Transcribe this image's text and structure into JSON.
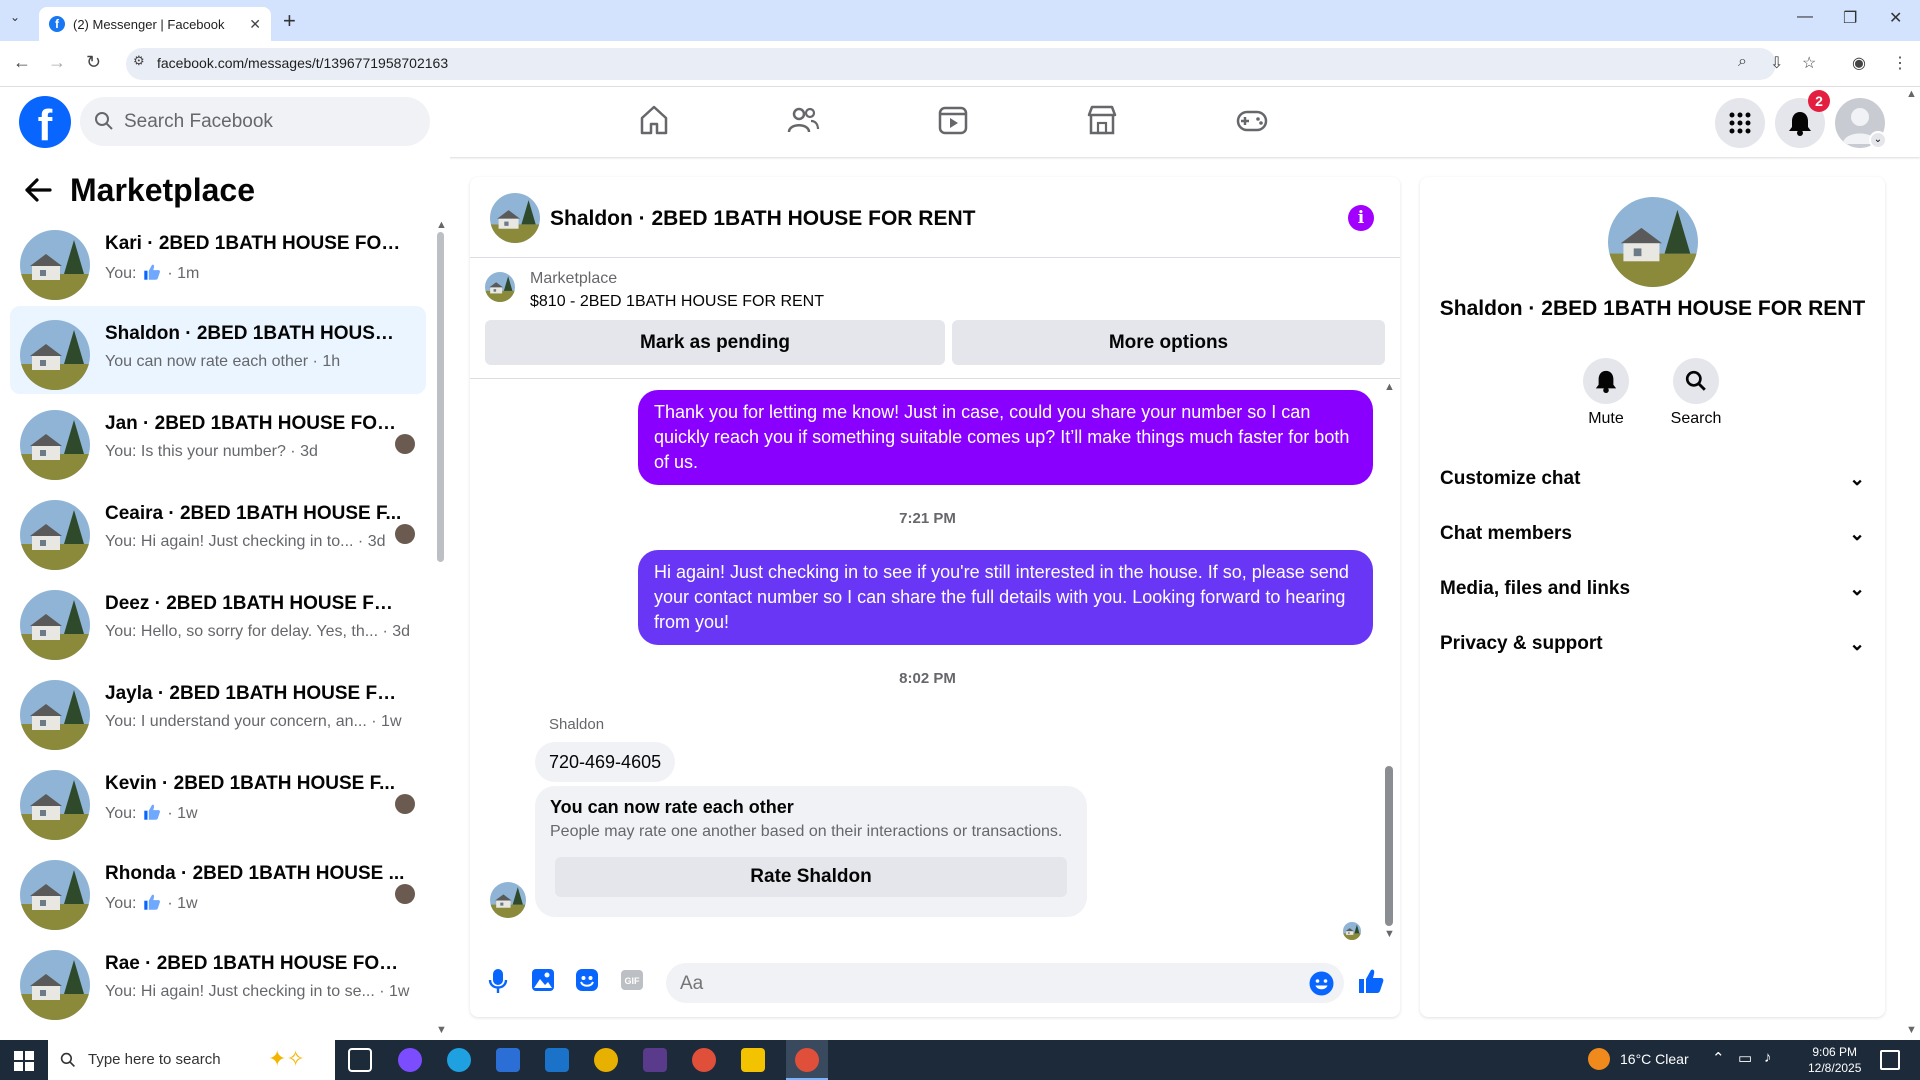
{
  "browser": {
    "tab_title": "(2) Messenger | Facebook",
    "url": "facebook.com/messages/t/1396771958702163"
  },
  "fb": {
    "search_placeholder": "Search Facebook",
    "notification_count": "2"
  },
  "left": {
    "title": "Marketplace",
    "conversations": [
      {
        "name": "Kari · 2BED 1BATH HOUSE FOR R...",
        "preview_prefix": "You:",
        "preview": "",
        "has_like": true,
        "time": "1m",
        "selected": false,
        "small_avatar": false
      },
      {
        "name": "Shaldon · 2BED 1BATH HOUSE F...",
        "preview_prefix": "",
        "preview": "You can now rate each other",
        "has_like": false,
        "time": "1h",
        "selected": true,
        "small_avatar": false
      },
      {
        "name": "Jan · 2BED 1BATH HOUSE FOR ...",
        "preview_prefix": "You:",
        "preview": "Is this your number?",
        "has_like": false,
        "time": "3d",
        "selected": false,
        "small_avatar": true
      },
      {
        "name": "Ceaira · 2BED 1BATH HOUSE F...",
        "preview_prefix": "You:",
        "preview": "Hi again! Just checking in to...",
        "has_like": false,
        "time": "3d",
        "selected": false,
        "small_avatar": true
      },
      {
        "name": "Deez · 2BED 1BATH HOUSE FOR ...",
        "preview_prefix": "You:",
        "preview": "Hello, so sorry for delay. Yes, th...",
        "has_like": false,
        "time": "3d",
        "selected": false,
        "small_avatar": false
      },
      {
        "name": "Jayla · 2BED 1BATH HOUSE FOR ...",
        "preview_prefix": "You:",
        "preview": "I understand your concern, an...",
        "has_like": false,
        "time": "1w",
        "selected": false,
        "small_avatar": false
      },
      {
        "name": "Kevin · 2BED 1BATH HOUSE F...",
        "preview_prefix": "You:",
        "preview": "",
        "has_like": true,
        "time": "1w",
        "selected": false,
        "small_avatar": true
      },
      {
        "name": "Rhonda · 2BED 1BATH HOUSE ...",
        "preview_prefix": "You:",
        "preview": "",
        "has_like": true,
        "time": "1w",
        "selected": false,
        "small_avatar": true
      },
      {
        "name": "Rae · 2BED 1BATH HOUSE FOR R...",
        "preview_prefix": "You:",
        "preview": "Hi again! Just checking in to se...",
        "has_like": false,
        "time": "1w",
        "selected": false,
        "small_avatar": false
      }
    ]
  },
  "chat": {
    "title": "Shaldon · 2BED 1BATH HOUSE FOR RENT",
    "marketplace_label": "Marketplace",
    "item": "$810 - 2BED 1BATH HOUSE FOR RENT",
    "btn_pending": "Mark as pending",
    "btn_more": "More options",
    "msg1": "Thank you for letting me know! Just in case, could you share your number so I can quickly reach you if something suitable comes up? It’ll make things much faster for both of us.",
    "time1": "7:21 PM",
    "msg2": "Hi again! Just checking in to see if you're still interested in the house. If so, please send your contact number so I can share the full details with you. Looking forward to hearing from you!",
    "time2": "8:02 PM",
    "sender": "Shaldon",
    "phone": "720-469-4605",
    "rate_title": "You can now rate each other",
    "rate_desc": "People may rate one another based on their interactions or transactions.",
    "rate_btn": "Rate Shaldon",
    "input_placeholder": "Aa",
    "colors": {
      "bubble1": "#8a00ff",
      "bubble2": "#6a36f5",
      "accent": "#0866ff",
      "info": "#a100ff"
    }
  },
  "right": {
    "name": "Shaldon · 2BED 1BATH HOUSE FOR RENT",
    "mute": "Mute",
    "search": "Search",
    "sections": [
      "Customize chat",
      "Chat members",
      "Media, files and links",
      "Privacy & support"
    ]
  },
  "taskbar": {
    "search": "Type here to search",
    "weather": "16°C  Clear",
    "time": "9:06 PM",
    "date": "12/8/2025"
  }
}
